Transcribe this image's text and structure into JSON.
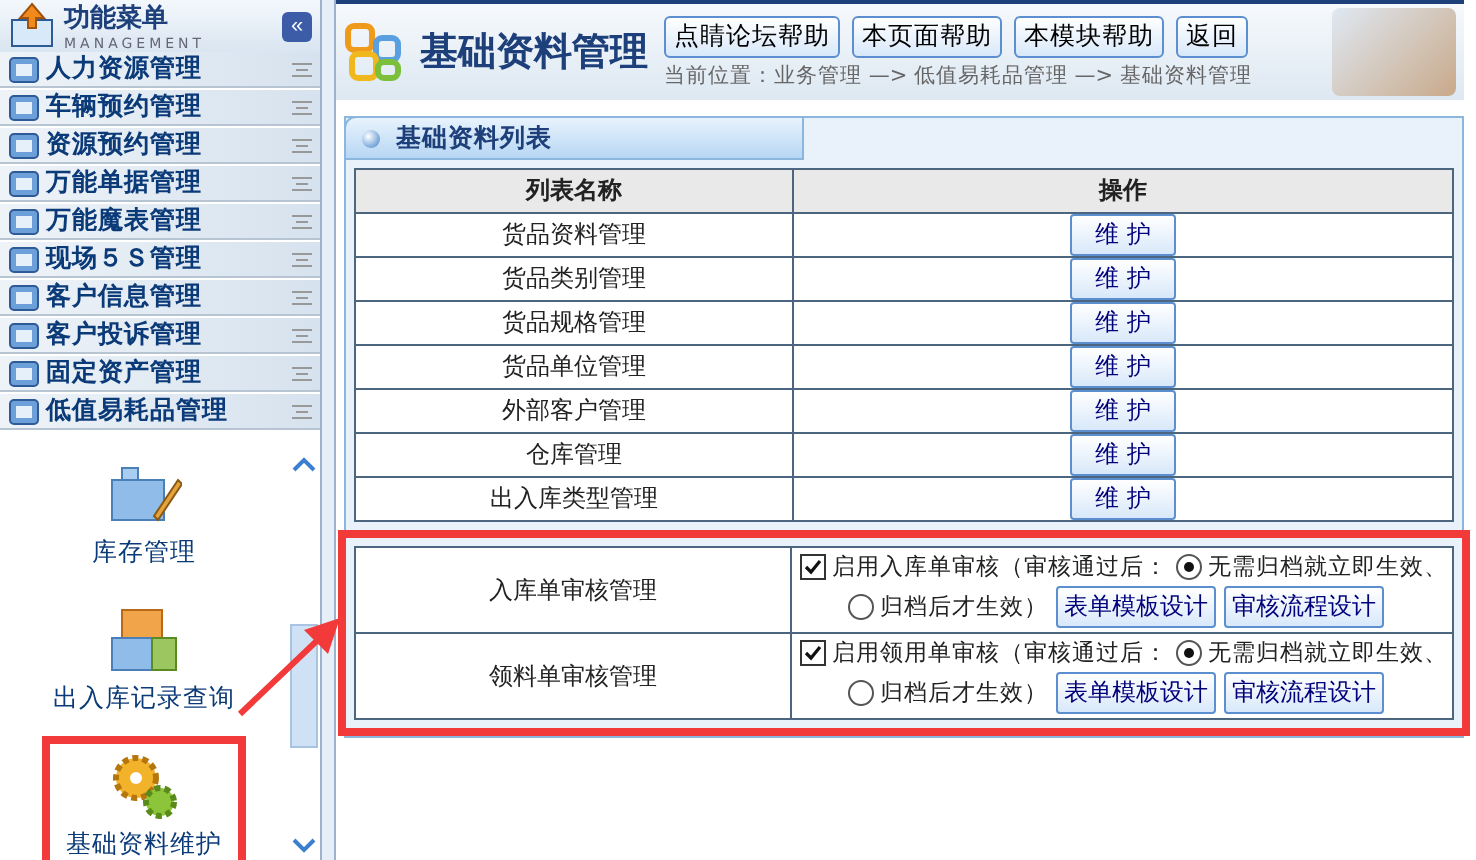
{
  "sidebar": {
    "title": "功能菜单",
    "subtitle": "MANAGEMENT",
    "collapse_button": "«",
    "items": [
      {
        "label": "人力资源管理"
      },
      {
        "label": "车辆预约管理"
      },
      {
        "label": "资源预约管理"
      },
      {
        "label": "万能单据管理"
      },
      {
        "label": "万能魔表管理"
      },
      {
        "label": "现场５Ｓ管理"
      },
      {
        "label": "客户信息管理"
      },
      {
        "label": "客户投诉管理"
      },
      {
        "label": "固定资产管理"
      },
      {
        "label": "低值易耗品管理"
      }
    ],
    "submenu": [
      {
        "label": "库存管理",
        "kind": "blocks",
        "highlighted": false
      },
      {
        "label": "出入库记录查询",
        "kind": "stack",
        "highlighted": false
      },
      {
        "label": "基础资料维护",
        "kind": "gears",
        "highlighted": true
      }
    ]
  },
  "header": {
    "title": "基础资料管理",
    "buttons": [
      "点睛论坛帮助",
      "本页面帮助",
      "本模块帮助",
      "返回"
    ],
    "breadcrumb": "当前位置：业务管理 —> 低值易耗品管理 —> 基础资料管理"
  },
  "panel": {
    "title": "基础资料列表",
    "columns": [
      "列表名称",
      "操作"
    ],
    "rows": [
      {
        "name": "货品资料管理",
        "action": "维 护"
      },
      {
        "name": "货品类别管理",
        "action": "维 护"
      },
      {
        "name": "货品规格管理",
        "action": "维 护"
      },
      {
        "name": "货品单位管理",
        "action": "维 护"
      },
      {
        "name": "外部客户管理",
        "action": "维 护"
      },
      {
        "name": "仓库管理",
        "action": "维 护"
      },
      {
        "name": "出入库类型管理",
        "action": "维 护"
      }
    ],
    "audit_rows": [
      {
        "name": "入库单审核管理",
        "checkbox": {
          "label": "启用入库单审核（审核通过后：",
          "checked": true
        },
        "options": [
          {
            "label": "无需归档就立即生效、",
            "selected": true
          },
          {
            "label": "归档后才生效）",
            "selected": false
          }
        ],
        "buttons": [
          "表单模板设计",
          "审核流程设计"
        ]
      },
      {
        "name": "领料单审核管理",
        "checkbox": {
          "label": "启用领用单审核（审核通过后：",
          "checked": true
        },
        "options": [
          {
            "label": "无需归档就立即生效、",
            "selected": true
          },
          {
            "label": "归档后才生效）",
            "selected": false
          }
        ],
        "buttons": [
          "表单模板设计",
          "审核流程设计"
        ]
      }
    ],
    "highlighted": true
  }
}
